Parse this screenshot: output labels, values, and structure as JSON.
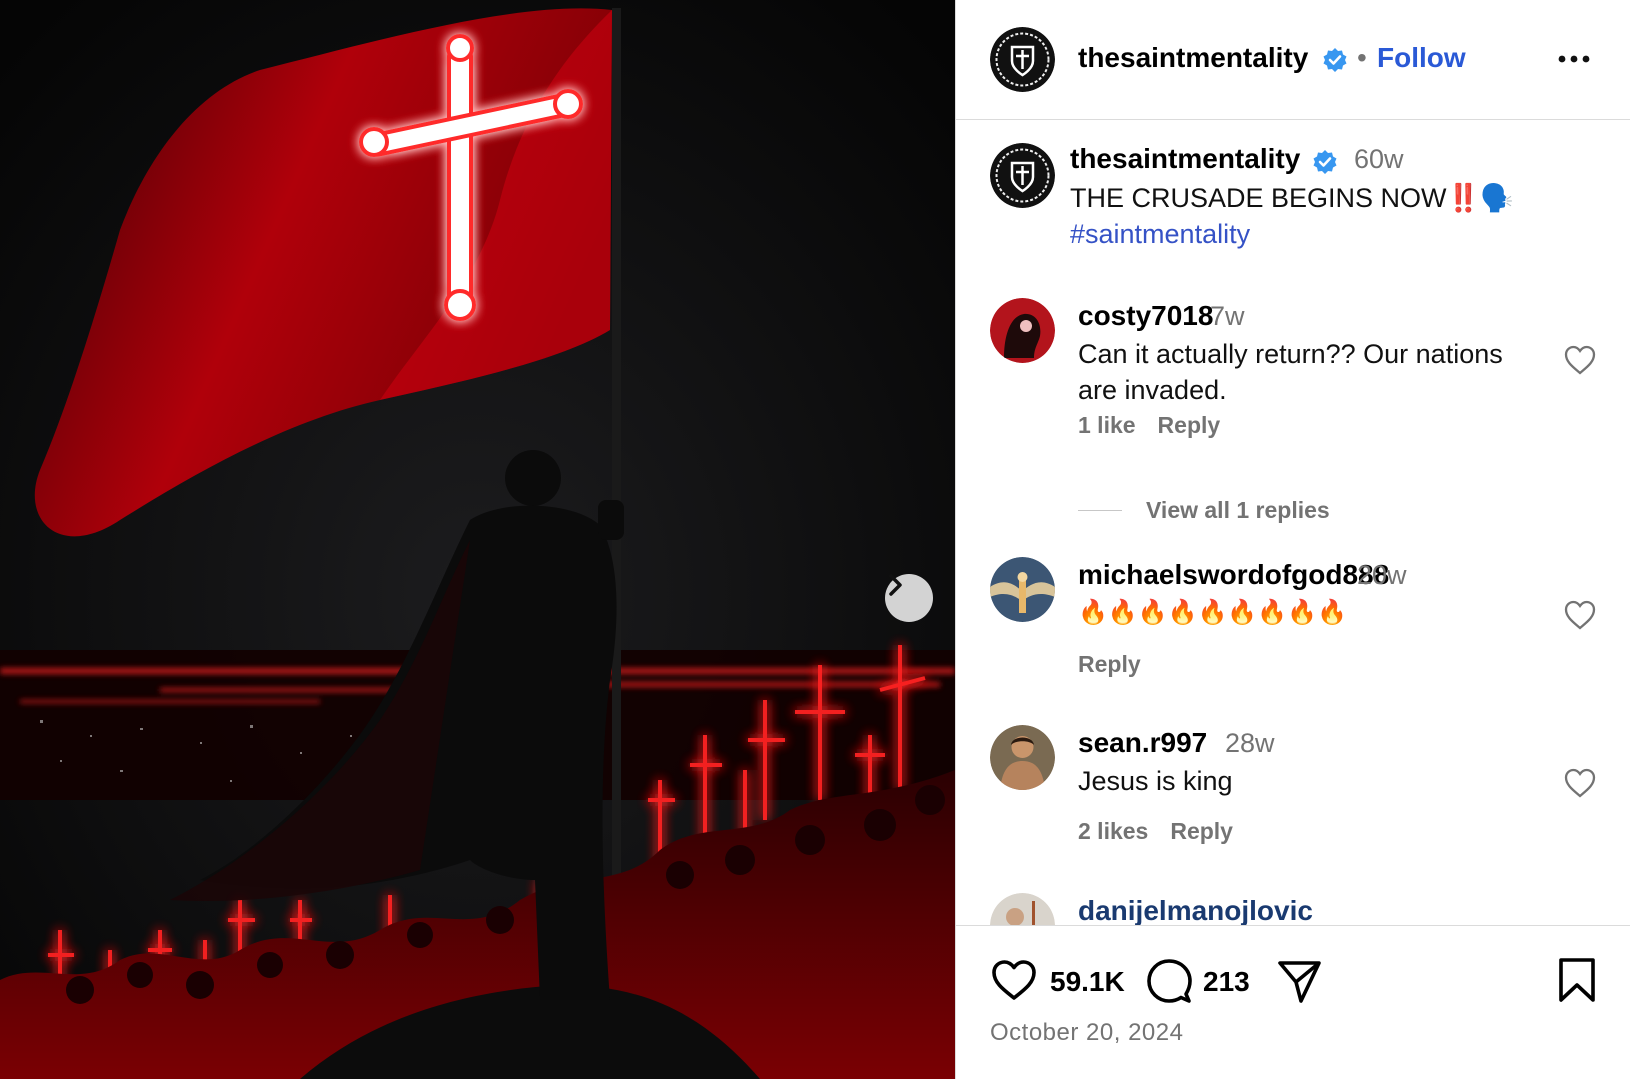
{
  "post": {
    "username": "thesaintmentality",
    "follow_label": "Follow",
    "separator": "•",
    "caption": {
      "time": "60w",
      "text": "THE CRUSADE BEGINS NOW‼️🗣️",
      "hashtag": "#saintmentality"
    }
  },
  "comments": [
    {
      "username": "costy7018",
      "time": "7w",
      "text": "Can it actually return?? Our nations are invaded.",
      "likes": "1 like",
      "reply": "Reply",
      "view_replies": "View all 1 replies"
    },
    {
      "username": "michaelswordofgod888",
      "time": "20w",
      "text": "🔥🔥🔥🔥🔥🔥🔥🔥🔥",
      "reply": "Reply"
    },
    {
      "username": "sean.r997",
      "time": "28w",
      "text": "Jesus is king",
      "likes": "2 likes",
      "reply": "Reply"
    },
    {
      "username": "danijelmanojlovic"
    }
  ],
  "stats": {
    "likes": "59.1K",
    "comments": "213",
    "date": "October 20, 2024"
  },
  "icons": {
    "verified": "verified-badge-icon",
    "next": "chevron-right-icon",
    "more": "more-options-icon",
    "like": "heart-icon",
    "comment": "comment-icon",
    "share": "share-icon",
    "save": "bookmark-icon"
  },
  "colors": {
    "follow": "#2a59d6",
    "hashtag": "#3552c6",
    "verified": "#3897f0",
    "muted": "#737373",
    "accent_red": "#ff1a1a"
  }
}
